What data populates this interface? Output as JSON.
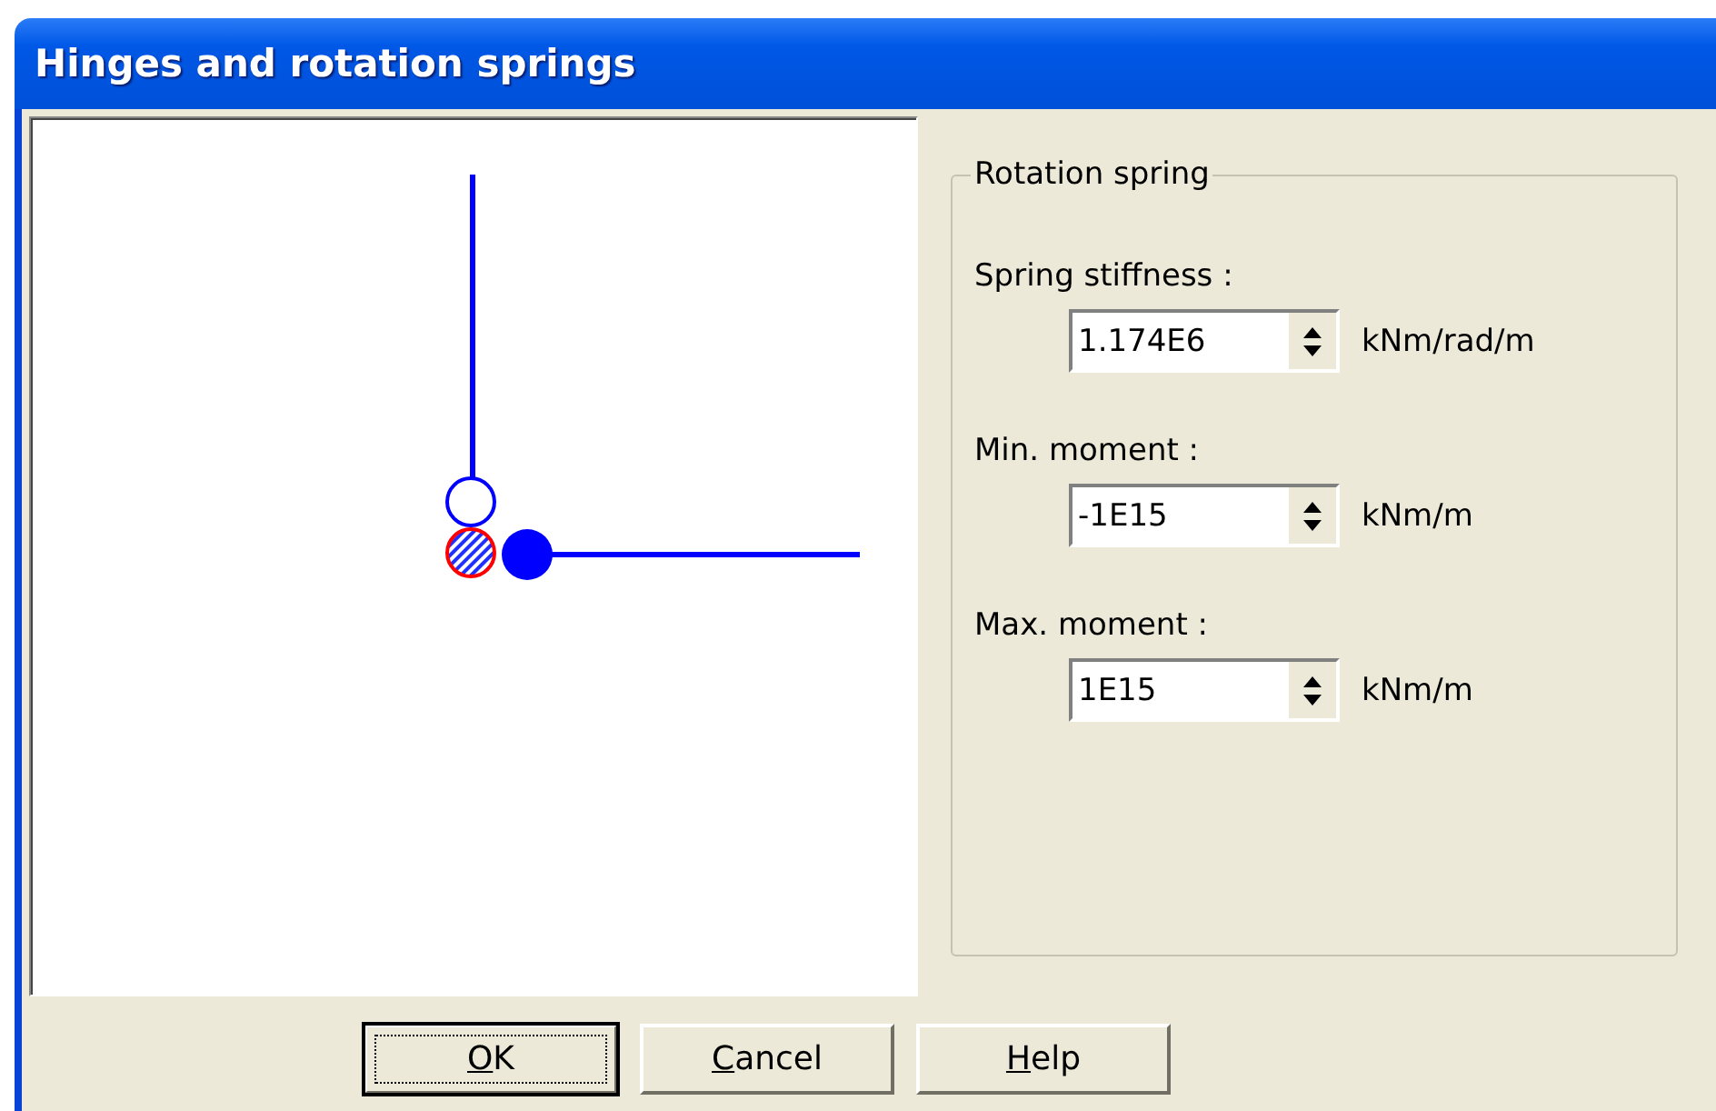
{
  "window": {
    "title": "Hinges and rotation springs"
  },
  "group": {
    "title": "Rotation spring",
    "fields": [
      {
        "label": "Spring stiffness :",
        "value": "1.174E6",
        "unit": "kNm/rad/m"
      },
      {
        "label": "Min. moment :",
        "value": "-1E15",
        "unit": "kNm/m"
      },
      {
        "label": "Max. moment :",
        "value": "1E15",
        "unit": "kNm/m"
      }
    ]
  },
  "buttons": [
    {
      "label": "OK",
      "default": true
    },
    {
      "label": "Cancel",
      "default": false
    },
    {
      "label": "Help",
      "default": false
    }
  ]
}
